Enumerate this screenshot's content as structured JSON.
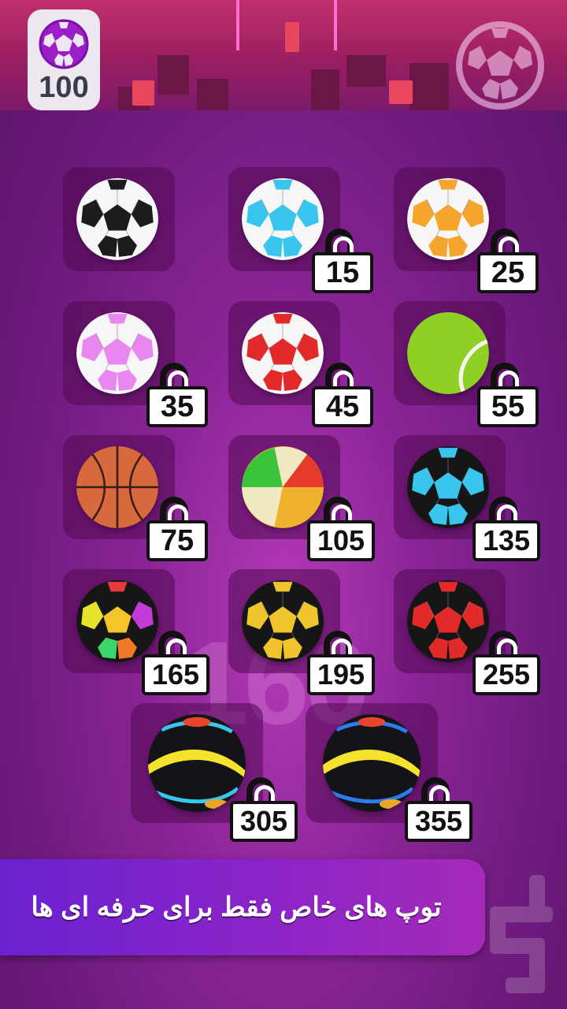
{
  "hud": {
    "coins": "100",
    "coin_icon": "soccer-ball-icon",
    "ball_select_icon": "soccer-ball-icon"
  },
  "background_number": "160",
  "balls": [
    {
      "name": "classic-soccer",
      "price": "",
      "locked": false,
      "color": "#1c1c1c"
    },
    {
      "name": "cyan-soccer",
      "price": "15",
      "locked": true,
      "color": "#39c6ee"
    },
    {
      "name": "orange-soccer",
      "price": "25",
      "locked": true,
      "color": "#f3a52c"
    },
    {
      "name": "pink-soccer",
      "price": "35",
      "locked": true,
      "color": "#e987f0"
    },
    {
      "name": "red-soccer",
      "price": "45",
      "locked": true,
      "color": "#e22a2a"
    },
    {
      "name": "tennis",
      "price": "55",
      "locked": true,
      "color": "#8ed124"
    },
    {
      "name": "basketball",
      "price": "75",
      "locked": true,
      "color": "#d8693c"
    },
    {
      "name": "beach",
      "price": "105",
      "locked": true,
      "color": "#f0b12c"
    },
    {
      "name": "black-cyan-soccer",
      "price": "135",
      "locked": true,
      "color": "#39c6ee"
    },
    {
      "name": "rainbow-soccer",
      "price": "165",
      "locked": true,
      "color": "#f0d02c"
    },
    {
      "name": "black-yellow-soccer",
      "price": "195",
      "locked": true,
      "color": "#f0c42c"
    },
    {
      "name": "black-red-soccer",
      "price": "255",
      "locked": true,
      "color": "#e22a2a"
    },
    {
      "name": "neon-yellow",
      "price": "305",
      "locked": true,
      "color": "#f4e22c"
    },
    {
      "name": "neon-blue",
      "price": "355",
      "locked": true,
      "color": "#2a7cf0"
    }
  ],
  "banner": {
    "text": "توپ های خاص فقط برای حرفه ای ها"
  },
  "colors": {
    "background": "#8a2496",
    "banner": "#8c24c8",
    "slot": "#50104f"
  }
}
